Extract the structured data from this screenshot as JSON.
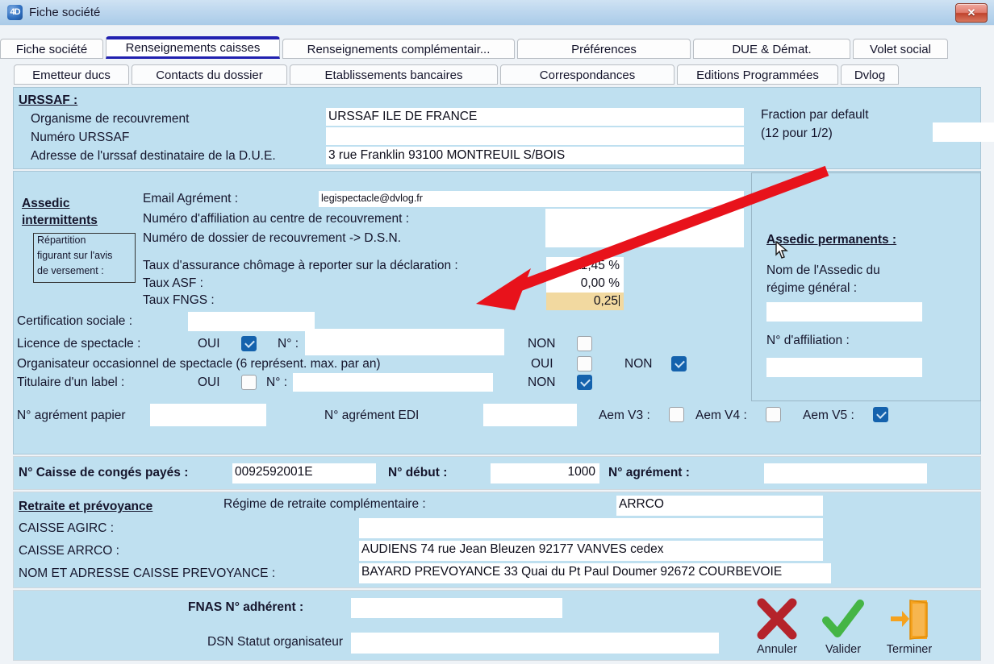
{
  "window": {
    "title": "Fiche société",
    "logo_label": "4D",
    "close_label": "✕"
  },
  "tabs_row1": [
    {
      "label": "Fiche société",
      "active": false
    },
    {
      "label": "Renseignements caisses",
      "active": true
    },
    {
      "label": "Renseignements complémentair...",
      "active": false
    },
    {
      "label": "Préférences",
      "active": false
    },
    {
      "label": "DUE & Démat.",
      "active": false
    },
    {
      "label": "Volet social",
      "active": false
    }
  ],
  "tabs_row2": [
    {
      "label": "Emetteur ducs"
    },
    {
      "label": "Contacts du dossier"
    },
    {
      "label": "Etablissements bancaires"
    },
    {
      "label": "Correspondances"
    },
    {
      "label": "Editions Programmées"
    },
    {
      "label": "Dvlog"
    }
  ],
  "urssaf": {
    "heading": "URSSAF :",
    "organisme_label": "Organisme de recouvrement",
    "organisme_value": "URSSAF ILE DE FRANCE",
    "numero_label": "Numéro URSSAF",
    "numero_value": "",
    "adresse_label": "Adresse de l'urssaf destinataire de la D.U.E.",
    "adresse_value": "3 rue Franklin 93100 MONTREUIL S/BOIS",
    "fraction_label_l1": "Fraction par default",
    "fraction_label_l2": "(12 pour 1/2)",
    "fraction_value": ""
  },
  "assedic_intermittents": {
    "heading_l1": "Assedic",
    "heading_l2": "intermittents",
    "note_l1": "Répartition",
    "note_l2": "figurant sur l'avis",
    "note_l3": "de versement :",
    "email_label": "Email Agrément :",
    "email_value": "legispectacle@dvlog.fr",
    "affiliation_label": "Numéro d'affiliation au centre de recouvrement :",
    "affiliation_value": "",
    "dossier_label": "Numéro de dossier de recouvrement -> D.S.N.",
    "dossier_value": "",
    "taux_chomage_label": "Taux d'assurance chômage à reporter sur la déclaration :",
    "taux_chomage_value": "11,45 %",
    "taux_asf_label": "Taux ASF :",
    "taux_asf_value": "0,00 %",
    "taux_fngs_label": "Taux FNGS :",
    "taux_fngs_value": "0,25",
    "focus_color": "#f2d9a0"
  },
  "certification": {
    "label": "Certification sociale :",
    "value": ""
  },
  "licence": {
    "label": "Licence de spectacle :",
    "oui_label": "OUI",
    "oui_checked": true,
    "num_label": "N° :",
    "num_value": "",
    "non_label": "NON",
    "non_checked": false
  },
  "organisateur": {
    "label": "Organisateur occasionnel de spectacle (6 représent. max. par an)",
    "oui_label": "OUI",
    "oui_checked": false,
    "non_label": "NON",
    "non_checked": true
  },
  "titulaire": {
    "label": "Titulaire d'un label :",
    "oui_label": "OUI",
    "oui_checked": false,
    "num_label": "N° :",
    "num_value": "",
    "non_label": "NON",
    "non_checked": true
  },
  "agrement": {
    "papier_label": "N° agrément papier",
    "papier_value": "",
    "edi_label": "N° agrément EDI",
    "edi_value": "",
    "aem_v3_label": "Aem V3 :",
    "aem_v3_checked": false,
    "aem_v4_label": "Aem V4 :",
    "aem_v4_checked": false,
    "aem_v5_label": "Aem V5 :",
    "aem_v5_checked": true
  },
  "assedic_permanents": {
    "heading": "Assedic permanents :",
    "nom_label_l1": "Nom de l'Assedic du",
    "nom_label_l2": "régime général :",
    "nom_value": "",
    "affiliation_label": "N° d'affiliation :",
    "affiliation_value": ""
  },
  "conges_payes": {
    "caisse_label": "N° Caisse de congés payés :",
    "caisse_value": "0092592001E",
    "debut_label": "N° début :",
    "debut_value": "1000",
    "agrement_label": "N° agrément :",
    "agrement_value": ""
  },
  "retraite": {
    "heading": "Retraite et prévoyance",
    "regime_label": "Régime de retraite complémentaire :",
    "regime_value": "ARRCO",
    "agirc_label": "CAISSE AGIRC :",
    "agirc_value": "",
    "arrco_label": "CAISSE ARRCO :",
    "arrco_value": "AUDIENS 74 rue Jean Bleuzen 92177 VANVES cedex",
    "prevoyance_label": "NOM ET ADRESSE CAISSE PREVOYANCE :",
    "prevoyance_value": "BAYARD PREVOYANCE 33 Quai du Pt Paul Doumer 92672 COURBEVOIE"
  },
  "bottom": {
    "fnas_label": "FNAS N° adhérent :",
    "fnas_value": "",
    "dsn_label": "DSN Statut organisateur",
    "dsn_value": "",
    "buttons": [
      {
        "label": "Annuler",
        "icon": "red-cross-icon",
        "color": "#b5232b"
      },
      {
        "label": "Valider",
        "icon": "green-check-icon",
        "color": "#45b545"
      },
      {
        "label": "Terminer",
        "icon": "orange-exit-door-icon",
        "color": "#f5a21e"
      }
    ]
  },
  "annotation": {
    "arrow_color": "#e8121b",
    "description": "red-arrow-pointing-to-taux-fngs"
  }
}
